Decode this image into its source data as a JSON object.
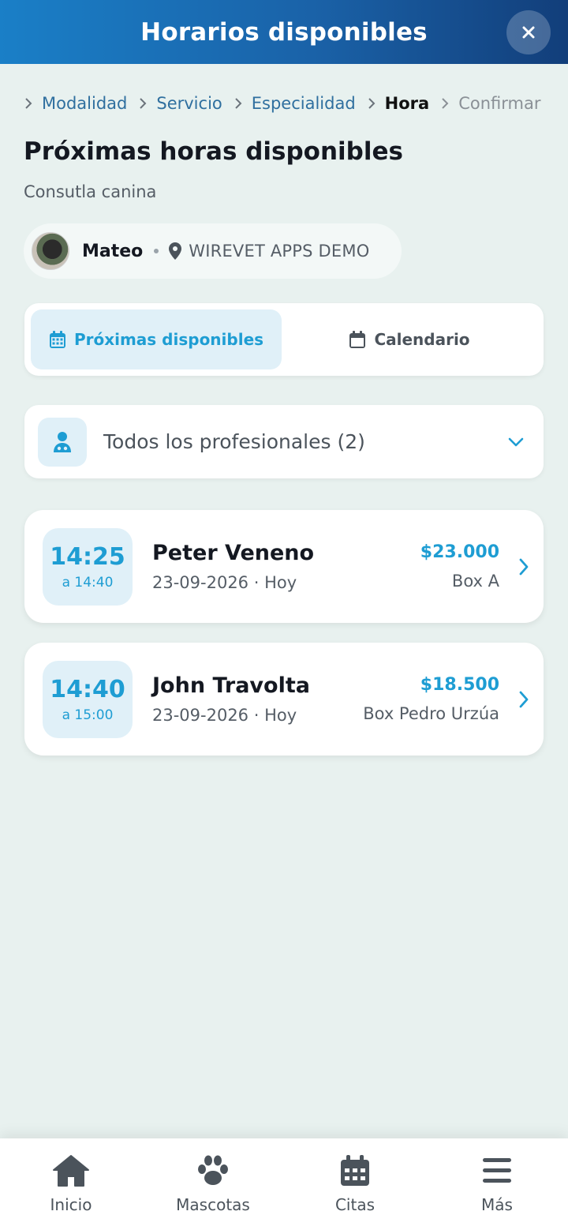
{
  "header": {
    "title": "Horarios disponibles"
  },
  "breadcrumb": [
    {
      "label": "Modalidad",
      "state": "link"
    },
    {
      "label": "Servicio",
      "state": "link"
    },
    {
      "label": "Especialidad",
      "state": "link"
    },
    {
      "label": "Hora",
      "state": "active"
    },
    {
      "label": "Confirmar",
      "state": "disabled"
    }
  ],
  "page": {
    "title": "Próximas horas disponibles",
    "subtitle": "Consutla canina"
  },
  "pet": {
    "name": "Mateo",
    "clinic": "WIREVET APPS DEMO"
  },
  "tabs": [
    {
      "label": "Próximas disponibles",
      "icon": "calendar-grid-icon",
      "active": true
    },
    {
      "label": "Calendario",
      "icon": "calendar-icon",
      "active": false
    }
  ],
  "filter": {
    "label": "Todos los profesionales (2)",
    "icon": "doctor-icon"
  },
  "slots": [
    {
      "start": "14:25",
      "end": "a 14:40",
      "professional": "Peter Veneno",
      "date": "23-09-2026 · Hoy",
      "price": "$23.000",
      "box": "Box A"
    },
    {
      "start": "14:40",
      "end": "a 15:00",
      "professional": "John Travolta",
      "date": "23-09-2026 · Hoy",
      "price": "$18.500",
      "box": "Box Pedro Urzúa"
    }
  ],
  "nav": [
    {
      "label": "Inicio",
      "icon": "home-icon"
    },
    {
      "label": "Mascotas",
      "icon": "paw-icon"
    },
    {
      "label": "Citas",
      "icon": "calendar-icon"
    },
    {
      "label": "Más",
      "icon": "menu-icon"
    }
  ],
  "colors": {
    "accent": "#1e9dd3",
    "header_start": "#1a7fc7",
    "header_end": "#123e7a",
    "background": "#e8f1ef"
  }
}
